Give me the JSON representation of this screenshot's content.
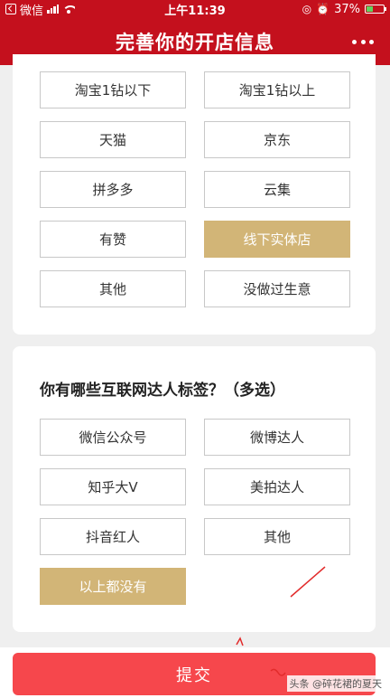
{
  "status_bar": {
    "carrier": "微信",
    "time": "上午11:39",
    "battery_text": "37%",
    "battery_level": 0.37,
    "signal_bars": 4
  },
  "nav": {
    "title": "完善你的开店信息",
    "more_icon": "more-horizontal-icon"
  },
  "platform_options": [
    {
      "label": "淘宝1钻以下",
      "selected": false
    },
    {
      "label": "淘宝1钻以上",
      "selected": false
    },
    {
      "label": "天猫",
      "selected": false
    },
    {
      "label": "京东",
      "selected": false
    },
    {
      "label": "拼多多",
      "selected": false
    },
    {
      "label": "云集",
      "selected": false
    },
    {
      "label": "有赞",
      "selected": false
    },
    {
      "label": "线下实体店",
      "selected": true
    },
    {
      "label": "其他",
      "selected": false
    },
    {
      "label": "没做过生意",
      "selected": false
    }
  ],
  "influencer_section": {
    "question": "你有哪些互联网达人标签？（多选）",
    "options": [
      {
        "label": "微信公众号",
        "selected": false
      },
      {
        "label": "微博达人",
        "selected": false
      },
      {
        "label": "知乎大V",
        "selected": false
      },
      {
        "label": "美拍达人",
        "selected": false
      },
      {
        "label": "抖音红人",
        "selected": false
      },
      {
        "label": "其他",
        "selected": false
      },
      {
        "label": "以上都没有",
        "selected": true
      }
    ]
  },
  "submit": {
    "label": "提交"
  },
  "watermark": "头条 @碎花裙的夏天",
  "colors": {
    "brand_red": "#c4101d",
    "selected_gold": "#d2b577",
    "submit_red": "#f6474c"
  }
}
